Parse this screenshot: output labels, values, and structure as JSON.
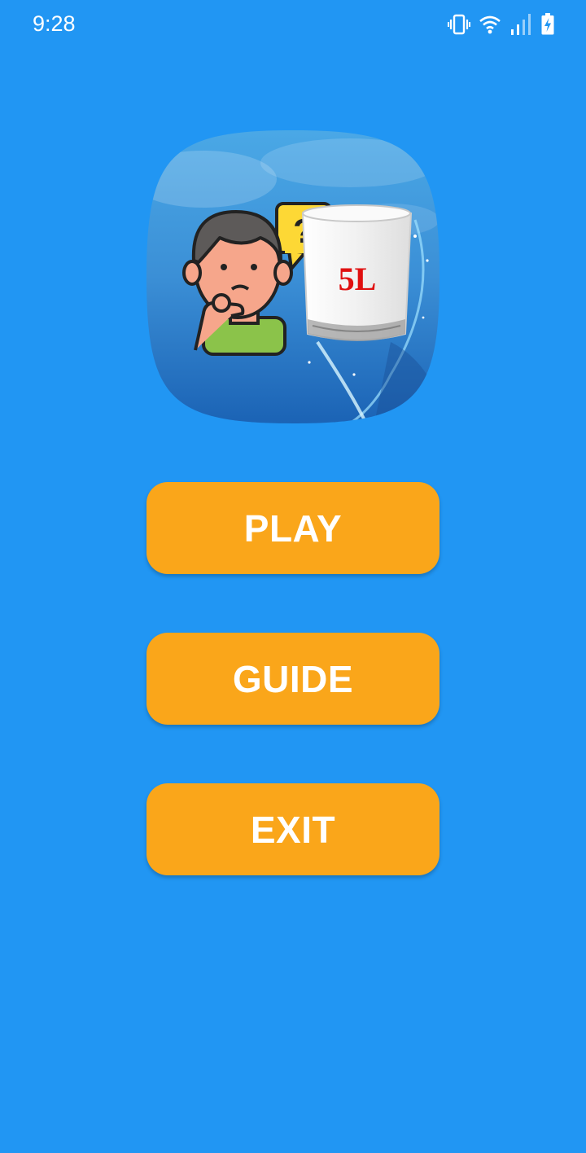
{
  "status_bar": {
    "time": "9:28",
    "icons": [
      "vibrate-icon",
      "wifi-icon",
      "signal-icon",
      "battery-charging-icon"
    ]
  },
  "logo": {
    "glass_label": "5L",
    "bubble_text": "?"
  },
  "menu": {
    "play_label": "PLAY",
    "guide_label": "GUIDE",
    "exit_label": "EXIT"
  },
  "colors": {
    "background": "#2196F3",
    "button": "#FAA61A",
    "button_text": "#FFFFFF",
    "glass_label": "#E01010"
  }
}
